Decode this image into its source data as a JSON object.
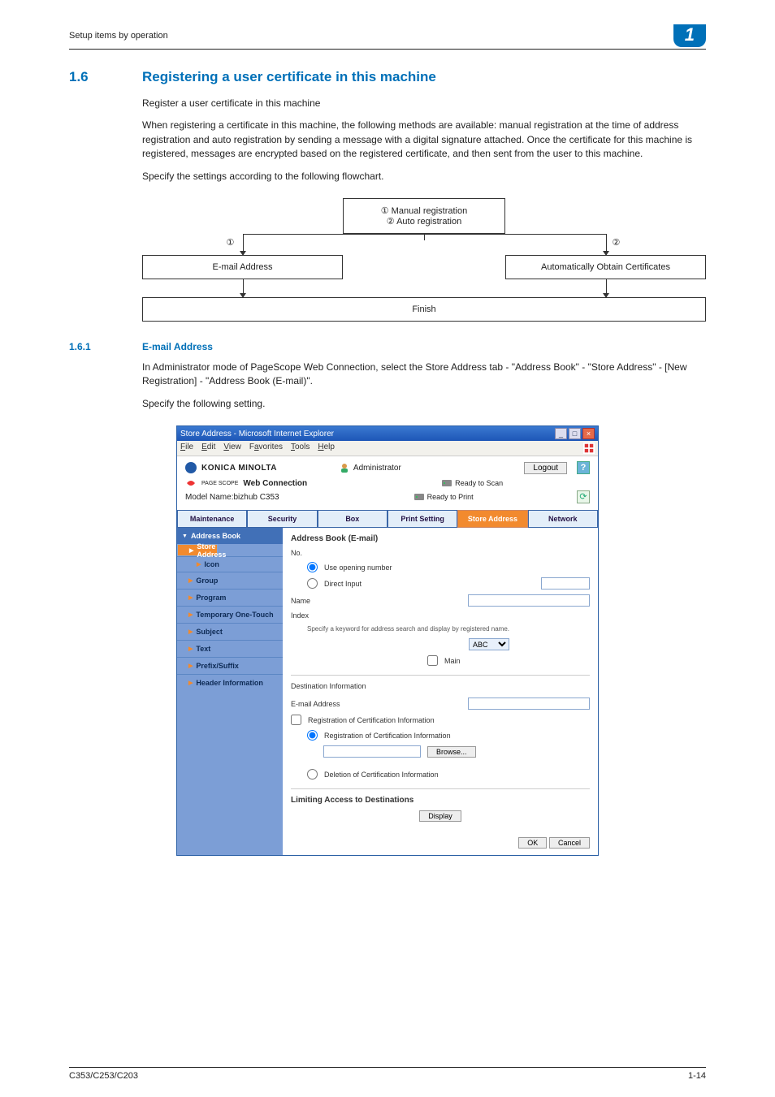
{
  "runhead": {
    "title": "Setup items by operation",
    "chapter": "1"
  },
  "h2": {
    "num": "1.6",
    "text": "Registering a user certificate in this machine"
  },
  "para1": "Register a user certificate in this machine",
  "para2": "When registering a certificate in this machine, the following methods are available: manual registration at the time of address registration and auto registration by sending a message with a digital signature attached. Once the certificate for this machine is registered, messages are encrypted based on the registered certificate, and then sent from the user to this machine.",
  "para3": "Specify the settings according to the following flowchart.",
  "flow": {
    "top1": "① Manual registration",
    "top2": "② Auto registration",
    "mark1": "①",
    "mark2": "②",
    "left": "E-mail Address",
    "right": "Automatically Obtain Certificates",
    "finish": "Finish"
  },
  "h3": {
    "num": "1.6.1",
    "text": "E-mail Address"
  },
  "para4": "In Administrator mode of PageScope Web Connection, select the Store Address tab - \"Address Book\" - \"Store Address\" - [New Registration] - \"Address Book (E-mail)\".",
  "para5": "Specify the following setting.",
  "win": {
    "title": "Store Address - Microsoft Internet Explorer",
    "menus": [
      "File",
      "Edit",
      "View",
      "Favorites",
      "Tools",
      "Help"
    ],
    "brand": "KONICA MINOLTA",
    "adminlabel": "Administrator",
    "logout": "Logout",
    "pslabel": "Web Connection",
    "pssub": "PAGE SCOPE",
    "model": "Model Name:bizhub C353",
    "status1": "Ready to Scan",
    "status2": "Ready to Print",
    "tabs": [
      "Maintenance",
      "Security",
      "Box",
      "Print Setting",
      "Store Address",
      "Network"
    ],
    "sidebar": {
      "head": "Address Book",
      "items": [
        "Store Address",
        "Icon",
        "Group",
        "Program",
        "Temporary One-Touch",
        "Subject",
        "Text",
        "Prefix/Suffix",
        "Header Information"
      ]
    },
    "form": {
      "heading": "Address Book (E-mail)",
      "no": "No.",
      "opt1": "Use opening number",
      "opt2": "Direct Input",
      "name": "Name",
      "index": "Index",
      "indexnote": "Specify a keyword for address search and display by registered name.",
      "indexsel": "ABC",
      "maincb": "Main",
      "destinfo": "Destination Information",
      "email": "E-mail Address",
      "regcb": "Registration of Certification Information",
      "regradio": "Registration of Certification Information",
      "browse": "Browse...",
      "delradio": "Deletion of Certification Information",
      "limiting": "Limiting Access to Destinations",
      "display": "Display",
      "ok": "OK",
      "cancel": "Cancel"
    }
  },
  "footer": {
    "left": "C353/C253/C203",
    "right": "1-14"
  }
}
